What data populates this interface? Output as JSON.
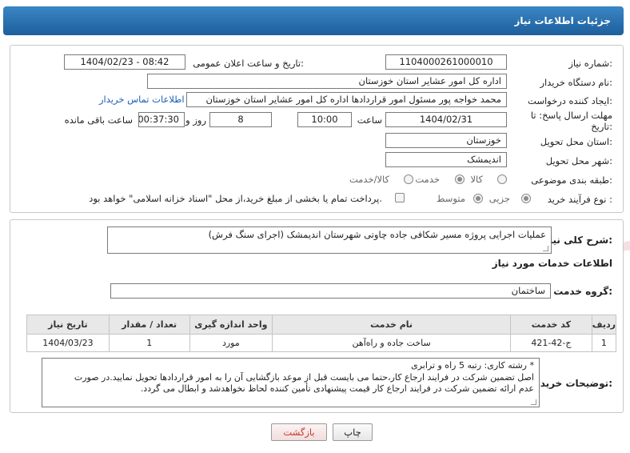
{
  "header": {
    "title": "جزئیات اطلاعات نیاز"
  },
  "form": {
    "need_number_label": "شماره نیاز:",
    "need_number": "1104000261000010",
    "announce_label": "تاریخ و ساعت اعلان عمومی:",
    "announce_value": "1404/02/23 - 08:42",
    "buyer_label": "نام دستگاه خریدار:",
    "buyer_value": "اداره کل امور عشایر استان خوزستان",
    "creator_label": "ایجاد کننده درخواست:",
    "creator_value": "محمد خواجه پور مسئول امور قراردادها اداره کل امور عشایر استان خوزستان",
    "contact_link": "اطلاعات تماس خریدار",
    "deadline_label_1": "مهلت ارسال پاسخ: تا",
    "deadline_label_2": "تاریخ:",
    "deadline_date": "1404/02/31",
    "time_label": "ساعت",
    "deadline_time": "10:00",
    "days_value": "8",
    "days_label": "روز و",
    "remaining_value": "00:37:30",
    "remaining_label": "ساعت باقی مانده",
    "province_label": "استان محل تحویل:",
    "province_value": "خوزستان",
    "city_label": "شهر محل تحویل:",
    "city_value": "اندیمشک",
    "category_label": "طبقه بندی موضوعی:",
    "category_options": [
      "کالا",
      "خدمت",
      "کالا/خدمت"
    ],
    "category_selected": "خدمت",
    "process_label": "نوع فرآیند خرید :",
    "process_options": [
      "جزیی",
      "متوسط"
    ],
    "process_selected": "جزیی",
    "payment_note": "پرداخت تمام یا بخشی از مبلغ خرید،از محل \"اسناد خزانه اسلامی\" خواهد بود."
  },
  "details": {
    "summary_label": "شرح کلی نیاز:",
    "summary_value": "عملیات اجرایی پروژه مسیر شکافی  جاده چاوتی  شهرستان اندیمشک     (اجرای سنگ فرش)",
    "services_title": "اطلاعات خدمات مورد نیاز",
    "group_label": "گروه خدمت:",
    "group_value": "ساختمان",
    "table": {
      "headers": [
        "ردیف",
        "کد خدمت",
        "نام خدمت",
        "واحد اندازه گیری",
        "تعداد / مقدار",
        "تاریخ نیاز"
      ],
      "rows": [
        [
          "1",
          "ج-42-421",
          "ساخت جاده و راه‌آهن",
          "مورد",
          "1",
          "1404/03/23"
        ]
      ]
    },
    "notes_label": "توضیحات خریدار:",
    "notes_lines": [
      "* رشته کاری: رتبه 5 راه و ترابری",
      "اصل تضمین شرکت در فرایند ارجاع کار،حتما می بایست قبل از موعد بازگشایی  آن را به امور قراردادها تحویل نمایید.در صورت",
      "عدم ارائه تضمین شرکت در فرایند ارجاع کار قیمت پیشنهادی تأمین کننده لحاظ نخواهدشد و ابطال می گردد."
    ]
  },
  "buttons": {
    "print": "چاپ",
    "back": "بازگشت"
  },
  "watermark": {
    "text": "AriaTender.neT"
  },
  "colors": {
    "header": "#2a73b5",
    "link": "#1b5fb4",
    "back_button_text": "#c0392b",
    "watermark": "#e8b9b9"
  }
}
